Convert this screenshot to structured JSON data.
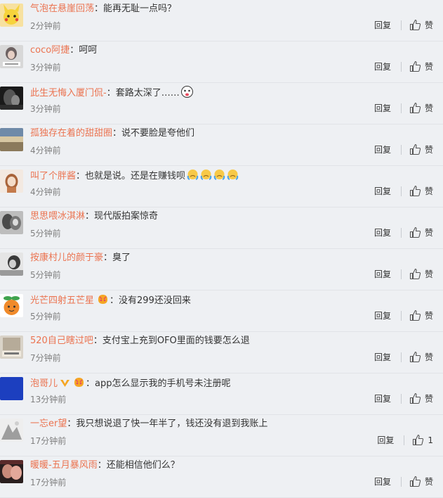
{
  "comments": [
    {
      "user": "气泡在悬崖回荡",
      "text": "能再无耻一点吗？",
      "time": "2分钟前",
      "like": "赞"
    },
    {
      "user": "coco阿捷",
      "text": "呵呵",
      "time": "3分钟前",
      "like": "赞"
    },
    {
      "user": "此生无悔入厦门侃-",
      "text": "套路太深了……",
      "time": "3分钟前",
      "like": "赞"
    },
    {
      "user": "孤独存在着的甜甜圈",
      "text": "说不要脸是夸他们",
      "time": "4分钟前",
      "like": "赞"
    },
    {
      "user": "叫了个胖酱",
      "text": "也就是说。还是在赚钱呗",
      "time": "4分钟前",
      "like": "赞"
    },
    {
      "user": "思思喂冰淇淋",
      "text": "现代版拍案惊奇",
      "time": "5分钟前",
      "like": "赞"
    },
    {
      "user": "按康村儿的颜于豪",
      "text": "臭了",
      "time": "5分钟前",
      "like": "赞"
    },
    {
      "user": "光芒四射五芒星",
      "text": "没有299还没回来",
      "time": "5分钟前",
      "like": "赞"
    },
    {
      "user": "520自己瞎过吧",
      "text": "支付宝上充到OFO里面的钱要怎么退",
      "time": "7分钟前",
      "like": "赞"
    },
    {
      "user": "泡哥儿",
      "text": "app怎么显示我的手机号未注册呢",
      "time": "13分钟前",
      "like": "赞"
    },
    {
      "user": "一忘er望",
      "text": "我只想说退了快一年半了，钱还没有退到我账上",
      "time": "17分钟前",
      "like": "1"
    },
    {
      "user": "暖暖-五月暴风雨",
      "text": "还能相信他们么？",
      "time": "17分钟前",
      "like": "赞"
    }
  ],
  "ui": {
    "reply_label": "回复",
    "separator": "："
  },
  "colors": {
    "username": "#eb7350",
    "text": "#333333",
    "time": "#808080",
    "background": "#eef0f3"
  }
}
